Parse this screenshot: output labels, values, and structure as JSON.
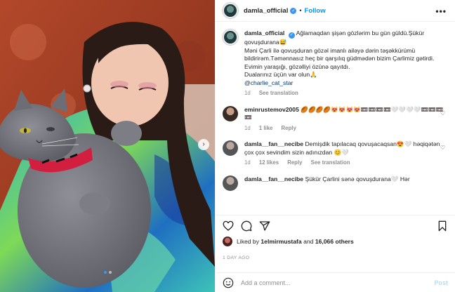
{
  "post": {
    "username": "damla_official",
    "follow_label": "Follow",
    "separator": "•",
    "more_label": "•••",
    "caption": {
      "username": "damla_official",
      "lines": [
        "Ağlamaqdan şişən gözlərim bu gün güldü.Şükür qovuşdurana😅",
        "Məni Çarli ilə qovuşduran gözəl imanlı ailəyə dərin təşəkkürümü bildirirəm.Təmənnasız heç bir qarşılıq güdmədən bizim Çarlimiz gətirdi.",
        "Evimin yaraşığı, gözəlliyi özünə qayıtdı.",
        "Dualarınız üçün var olun🙏"
      ],
      "mention": "@charlie_cat_star",
      "time": "1d",
      "see_translation": "See translation"
    },
    "comments": [
      {
        "username": "eminrustemov2005",
        "text": "🏉🏉🏉🏉😻😻😻😻📼📼📼📼🤍🤍🤍🤍📼📼📼📼",
        "time": "1d",
        "likes": "1 like",
        "reply": "Reply",
        "icon": "heart-icon"
      },
      {
        "username": "damla__fan__necibe",
        "text": "Demişdik tapılacaq qovuşacaqsan😍🤍 həqiqətən çox çox sevindim sizin adınızdan 😊🤍",
        "time": "1d",
        "likes": "12 likes",
        "reply": "Reply",
        "see_translation": "See translation",
        "icon": "heart-icon"
      },
      {
        "username": "damla__fan__necibe",
        "text": "Şükür Çarlini sənə qovuşdurana🤍 Hər",
        "time": "",
        "likes": "",
        "reply": ""
      }
    ],
    "likes": {
      "prefix": "Liked by",
      "user": "1elmirmustafa",
      "middle": "and",
      "count": "16,066 others"
    },
    "age": "1 DAY AGO",
    "add_comment": {
      "placeholder": "Add a comment...",
      "post_label": "Post"
    },
    "icons": {
      "like": "heart-icon",
      "comment": "comment-icon",
      "share": "share-icon",
      "save": "bookmark-icon",
      "emoji": "emoji-icon",
      "next": "chevron-right-icon"
    },
    "carousel": {
      "count": 2,
      "active": 1
    },
    "colors": {
      "link_blue": "#0095f6",
      "muted": "#8e8e8e",
      "post_disabled": "#b2dffc"
    }
  }
}
